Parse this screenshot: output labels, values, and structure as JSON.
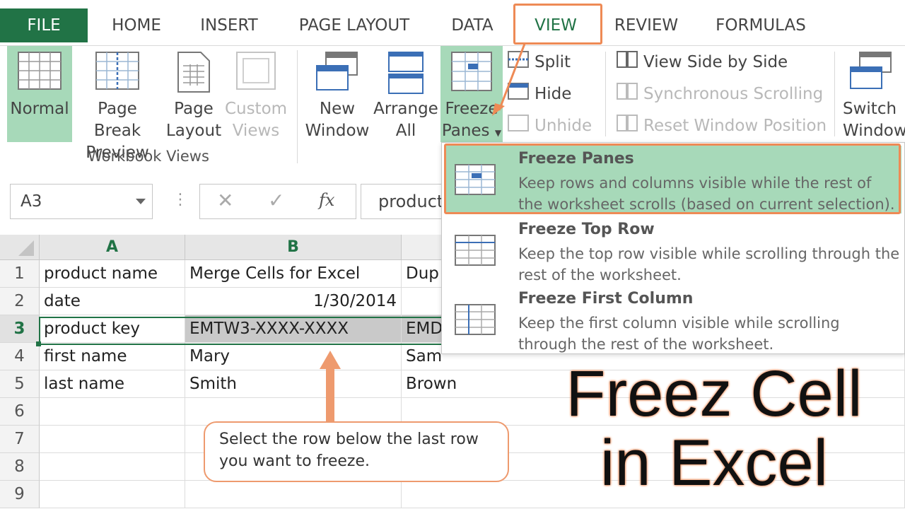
{
  "ribbon": {
    "tabs": [
      "FILE",
      "HOME",
      "INSERT",
      "PAGE LAYOUT",
      "DATA",
      "VIEW",
      "REVIEW",
      "FORMULAS"
    ],
    "active_tab": "VIEW",
    "workbook_views": {
      "group_label": "Workbook Views",
      "normal": "Normal",
      "page_break_1": "Page Break",
      "page_break_2": "Preview",
      "page_layout_1": "Page",
      "page_layout_2": "Layout",
      "custom_1": "Custom",
      "custom_2": "Views"
    },
    "window": {
      "new_1": "New",
      "new_2": "Window",
      "arrange_1": "Arrange",
      "arrange_2": "All",
      "freeze_1": "Freeze",
      "freeze_2": "Panes",
      "split": "Split",
      "hide": "Hide",
      "unhide": "Unhide",
      "side_by_side": "View Side by Side",
      "sync_scroll": "Synchronous Scrolling",
      "reset_pos": "Reset Window Position",
      "switch_1": "Switch",
      "switch_2": "Windows"
    }
  },
  "formula_bar": {
    "name_box": "A3",
    "fx": "fx",
    "content": "product key"
  },
  "sheet": {
    "columns": [
      "A",
      "B"
    ],
    "rows": [
      "1",
      "2",
      "3",
      "4",
      "5",
      "6",
      "7",
      "8",
      "9"
    ],
    "cells": {
      "a1": "product name",
      "b1": "Merge Cells for Excel",
      "c1": "Dup",
      "a2": "date",
      "b2": "1/30/2014",
      "a3": "product key",
      "b3": "EMTW3-XXXX-XXXX",
      "c3": "EMD",
      "a4": "first name",
      "b4": "Mary",
      "c4": "Sam",
      "a5": "last name",
      "b5": "Smith",
      "c5": "Brown"
    }
  },
  "dropdown": {
    "items": [
      {
        "title": "Freeze Panes",
        "desc": "Keep rows and columns visible while the rest of the worksheet scrolls (based on current selection)."
      },
      {
        "title": "Freeze Top Row",
        "desc": "Keep the top row visible while scrolling through the rest of the worksheet."
      },
      {
        "title": "Freeze First Column",
        "desc": "Keep the first column visible while scrolling through the rest of the worksheet."
      }
    ]
  },
  "annotation": {
    "callout_line1": "Select the row below the last row",
    "callout_line2": "you want to freeze.",
    "title_line1": "Freez Cell",
    "title_line2": "in Excel"
  },
  "colors": {
    "excel_green": "#217346",
    "highlight_green": "#a7d9b9",
    "annotation_orange": "#ee8a55"
  }
}
